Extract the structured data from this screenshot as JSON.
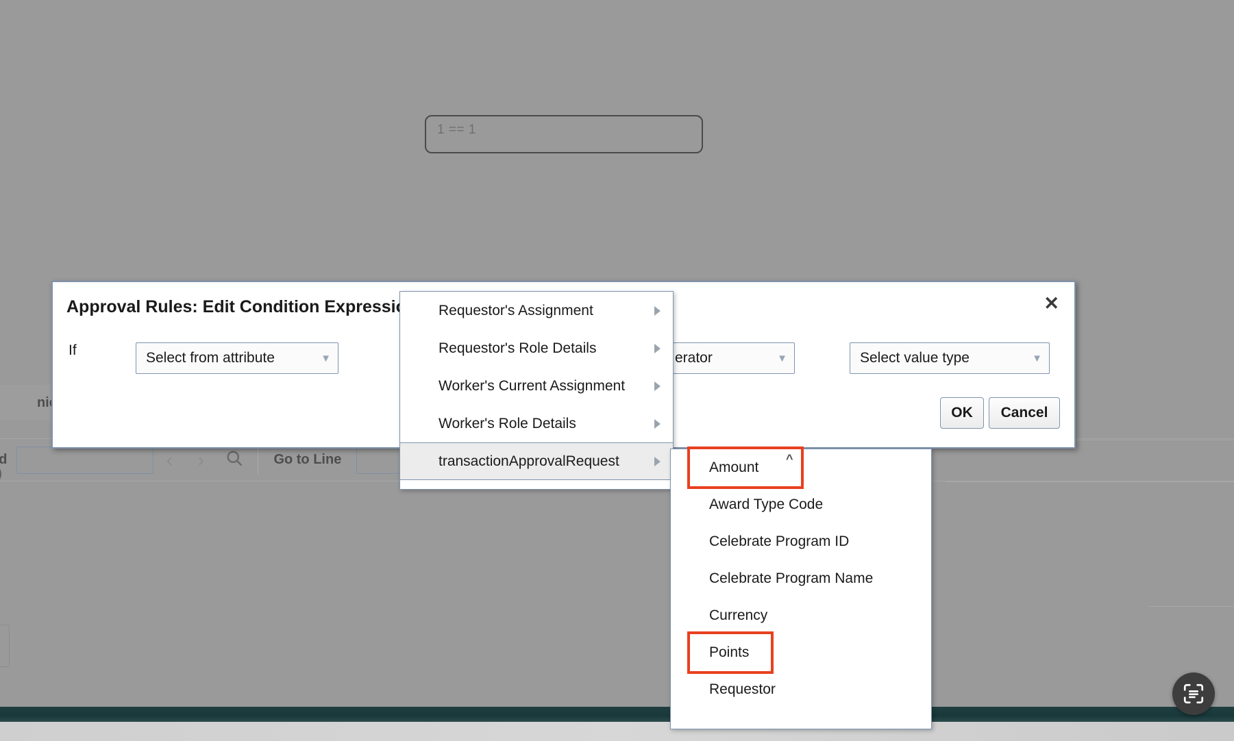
{
  "background": {
    "expression": "1 == 1",
    "tab_label": "nics",
    "toolbar": {
      "find_label": "nd",
      "find_value": "",
      "prev_icon": "chevron-left-icon",
      "next_icon": "chevron-right-icon",
      "search_icon": "search-icon",
      "goto_line_label": "Go to Line",
      "goto_line_value": ""
    },
    "stray_paren": ")",
    "fab_icon": "document-scan-icon"
  },
  "dialog": {
    "title": "Approval Rules: Edit Condition Expression",
    "close_icon": "close-icon",
    "if_label": "If",
    "attribute_select": {
      "value": "Select from attribute",
      "chevron": "chevron-down-icon"
    },
    "operator_select": {
      "value": "Select operator",
      "visible_text": "erator",
      "chevron": "chevron-down-icon"
    },
    "value_type_select": {
      "value": "Select value type",
      "chevron": "chevron-down-icon"
    },
    "ok_label": "OK",
    "cancel_label": "Cancel"
  },
  "menu": {
    "items": [
      {
        "label": "Requestor's Assignment",
        "has_submenu": true,
        "selected": false
      },
      {
        "label": "Requestor's Role Details",
        "has_submenu": true,
        "selected": false
      },
      {
        "label": "Worker's Current Assignment",
        "has_submenu": true,
        "selected": false
      },
      {
        "label": "Worker's Role Details",
        "has_submenu": true,
        "selected": false
      },
      {
        "label": "transactionApprovalRequest",
        "has_submenu": true,
        "selected": true
      }
    ]
  },
  "submenu": {
    "scroll_up_icon": "chevron-up-icon",
    "items": [
      {
        "label": "Amount",
        "highlighted": true
      },
      {
        "label": "Award Type Code",
        "highlighted": false
      },
      {
        "label": "Celebrate Program ID",
        "highlighted": false
      },
      {
        "label": "Celebrate Program Name",
        "highlighted": false
      },
      {
        "label": "Currency",
        "highlighted": false
      },
      {
        "label": "Points",
        "highlighted": true
      },
      {
        "label": "Requestor",
        "highlighted": false
      }
    ]
  },
  "colors": {
    "highlight_red": "#e8401f",
    "border_blue": "#7e93ad",
    "overlay_gray": "#9a9a9a",
    "menu_selected": "#ececec",
    "bottom_bar_dark": "#1d3b3d"
  }
}
